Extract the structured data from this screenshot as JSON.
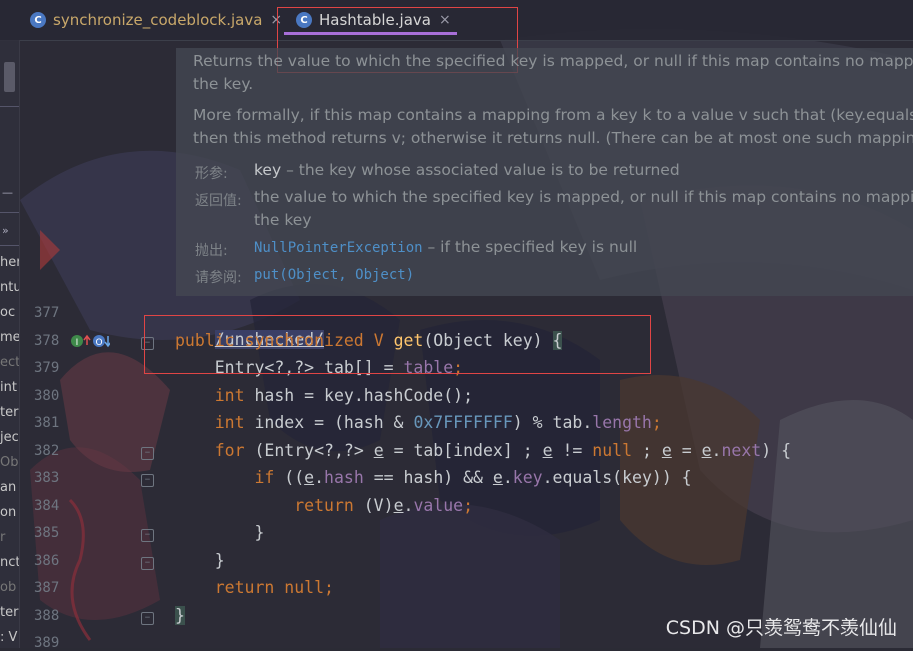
{
  "tabs": [
    {
      "label": "synchronize_codeblock.java",
      "icon": "java-class-icon",
      "close": "×"
    },
    {
      "label": "Hashtable.java",
      "icon": "java-class-icon",
      "close": "×",
      "active": true
    }
  ],
  "left_strip": {
    "partial_words": [
      "her",
      "ntu",
      "oc",
      "me",
      "ect",
      "int",
      "ter",
      "jec",
      "Ob",
      "an",
      "on",
      "r",
      "nct",
      "ob",
      "ter",
      ": V"
    ]
  },
  "doc": {
    "line1": "Returns the value to which the specified key is mapped, or null if this map contains no mappi",
    "line2": "the key.",
    "line3": "More formally, if this map contains a mapping from a key k to a value v such that (key.equals",
    "line4": "then this method returns v; otherwise it returns null. (There can be at most one such mapping",
    "params_label": "形参:",
    "params_key": "key",
    "params_desc": " – the key whose associated value is to be returned",
    "returns_label": "返回值:",
    "returns_line1": "the value to which the specified key is mapped, or null if this map contains no mappi",
    "returns_line2": "the key",
    "throws_label": "抛出:",
    "throws_link": "NullPointerException",
    "throws_desc": " – if the specified key is null",
    "see_label": "请参阅:",
    "see_link": "put(Object, Object)"
  },
  "line_numbers": [
    "377",
    "378",
    "379",
    "380",
    "381",
    "382",
    "383",
    "384",
    "385",
    "386",
    "387",
    "388",
    "389"
  ],
  "code": {
    "l377": "/unchecked/",
    "l378_kw": "public synchronized ",
    "l378_type": "V ",
    "l378_fn": "get",
    "l378_rest": "(Object key) ",
    "l378_brace": "{",
    "l379_a": "    Entry<?,?> tab[] = ",
    "l379_b": "table",
    "l379_c": ";",
    "l380_kw": "    int ",
    "l380_rest": "hash = key.hashCode();",
    "l381_kw": "    int ",
    "l381_a": "index = (hash & ",
    "l381_num": "0x7FFFFFFF",
    "l381_b": ") % tab.",
    "l381_fld": "length",
    "l381_c": ";",
    "l382_kw": "    for ",
    "l382_a": "(Entry<?,?> ",
    "l382_e1": "e",
    "l382_b": " = tab[index] ; ",
    "l382_e2": "e",
    "l382_c": " != ",
    "l382_null": "null",
    "l382_d": " ; ",
    "l382_e3": "e",
    "l382_e": " = ",
    "l382_e4": "e",
    "l382_f": ".",
    "l382_next": "next",
    "l382_g": ") {",
    "l383_kw": "        if ",
    "l383_a": "((",
    "l383_e1": "e",
    "l383_b": ".",
    "l383_hash": "hash",
    "l383_c": " == hash) && ",
    "l383_e2": "e",
    "l383_d": ".",
    "l383_key": "key",
    "l383_e": ".equals(key)) {",
    "l384_kw": "            return ",
    "l384_a": "(V)",
    "l384_e": "e",
    "l384_b": ".",
    "l384_val": "value",
    "l384_c": ";",
    "l385": "        }",
    "l386": "    }",
    "l387_kw": "    return ",
    "l387_null": "null",
    "l387_c": ";",
    "l388": "}"
  },
  "watermark": "CSDN @只羡鸳鸯不羡仙仙",
  "colors": {
    "keyword": "#cc7832",
    "function": "#ffc66d",
    "number": "#6897bb",
    "field": "#9876aa",
    "highlight_box": "#e04545",
    "tab_underline": "#a86fd8"
  }
}
